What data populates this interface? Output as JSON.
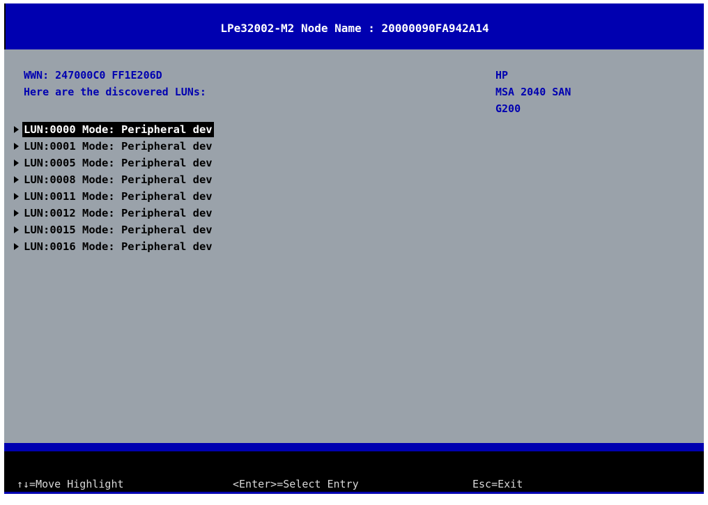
{
  "header": {
    "title": "LPe32002-M2 Node Name : 20000090FA942A14"
  },
  "info": {
    "wwn": "WWN: 247000C0 FF1E206D",
    "discovered": "Here are the discovered LUNs:",
    "vendor": "HP",
    "product": "MSA 2040 SAN",
    "revision": "G200"
  },
  "luns": [
    "LUN:0000 Mode: Peripheral dev",
    "LUN:0001 Mode: Peripheral dev",
    "LUN:0005 Mode: Peripheral dev",
    "LUN:0008 Mode: Peripheral dev",
    "LUN:0011 Mode: Peripheral dev",
    "LUN:0012 Mode: Peripheral dev",
    "LUN:0015 Mode: Peripheral dev",
    "LUN:0016 Mode: Peripheral dev"
  ],
  "footer": {
    "move": "↑↓=Move Highlight",
    "select": "<Enter>=Select Entry",
    "exit": "Esc=Exit"
  }
}
